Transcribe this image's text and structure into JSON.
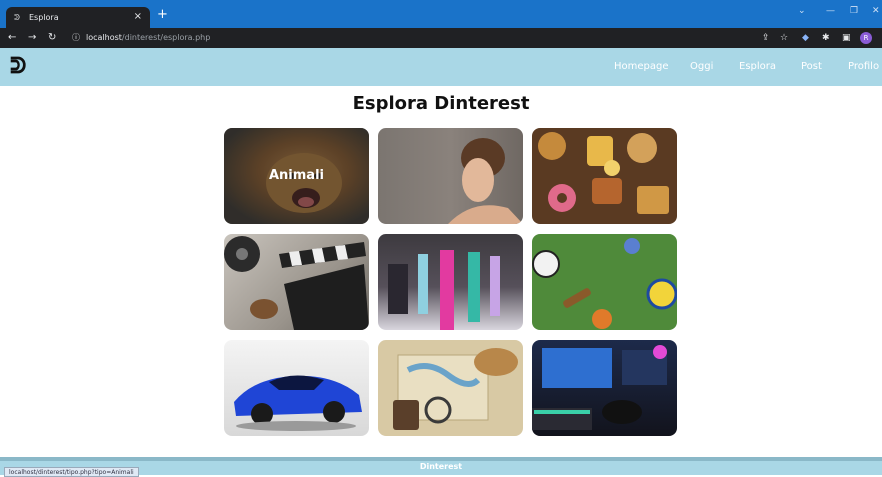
{
  "browser": {
    "tab_title": "Esplora",
    "tab_close": "×",
    "new_tab": "+",
    "url_host": "localhost",
    "url_path": "/dinterest/esplora.php",
    "avatar": "R",
    "status_url": "localhost/dinterest/tipo.php?tipo=Animali"
  },
  "header": {
    "logo": "ᕲ",
    "menu": [
      "Homepage",
      "Oggi",
      "Esplora",
      "Post",
      "Profilo"
    ]
  },
  "main": {
    "title": "Esplora Dinterest",
    "categories": [
      {
        "label": "Animali",
        "image": "dog-photo"
      },
      {
        "label": "",
        "image": "fashion-portrait-photo"
      },
      {
        "label": "",
        "image": "junk-food-photo"
      },
      {
        "label": "",
        "image": "cinema-clapperboard-photo"
      },
      {
        "label": "",
        "image": "fashion-runway-photo"
      },
      {
        "label": "",
        "image": "sports-equipment-photo"
      },
      {
        "label": "",
        "image": "blue-sports-car-photo"
      },
      {
        "label": "",
        "image": "travel-map-photo"
      },
      {
        "label": "",
        "image": "gaming-setup-photo"
      }
    ]
  },
  "footer": {
    "text": "Dinterest"
  }
}
